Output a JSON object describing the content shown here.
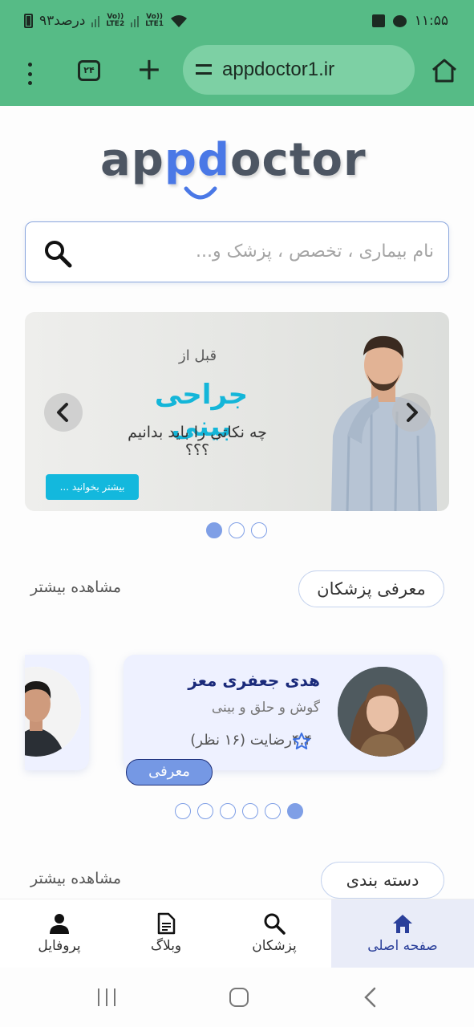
{
  "status_bar": {
    "time": "۱۱:۵۵",
    "battery_text": "۹۳درصد",
    "lte1": "LTE1",
    "lte2": "LTE2",
    "volte": "Vo))"
  },
  "browser": {
    "url": "appdoctor1.ir",
    "tab_count": "۲۴"
  },
  "logo": {
    "part1": "ap",
    "part2": "pd",
    "part3": "octor"
  },
  "search": {
    "placeholder": "نام بیماری ، تخصص ، پزشک و..."
  },
  "banner": {
    "pretitle": "قبل از",
    "title": "جراحی بینی",
    "subtitle": "چه نکاتی را باید بدانیم ؟؟؟",
    "button": "بیشتر بخوانید ...",
    "slide_count": 3,
    "active_slide": 1
  },
  "doctors_section": {
    "title": "معرفی پزشکان",
    "more": "مشاهده بیشتر",
    "doctor": {
      "name": "هدی جعفری معز",
      "specialty": "گوش و حلق و بینی",
      "rating": "۴.۴رضایت (۱۶ نظر)",
      "button": "معرفی"
    },
    "slide_count": 6,
    "active_slide": 6
  },
  "categories_section": {
    "title": "دسته بندی",
    "more": "مشاهده بیشتر"
  },
  "bottom_nav": {
    "items": [
      {
        "label": "صفحه اصلی",
        "icon": "home-icon",
        "active": true
      },
      {
        "label": "پزشکان",
        "icon": "search-icon",
        "active": false
      },
      {
        "label": "وبلاگ",
        "icon": "document-icon",
        "active": false
      },
      {
        "label": "پروفایل",
        "icon": "person-icon",
        "active": false
      }
    ]
  },
  "colors": {
    "browser_green": "#56bb86",
    "brand_blue": "#4a78e6",
    "banner_cyan": "#14b6d9",
    "active_nav_bg": "#e9ecf8"
  }
}
